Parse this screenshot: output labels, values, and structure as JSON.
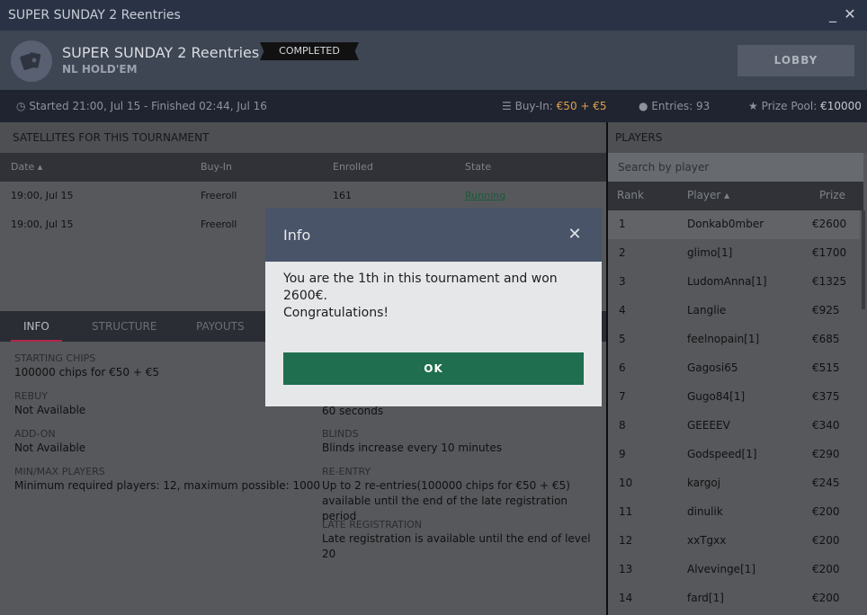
{
  "window": {
    "title": "SUPER SUNDAY 2 Reentries",
    "minimize": "_",
    "close": "✕"
  },
  "header": {
    "name": "SUPER SUNDAY 2 Reentries",
    "game": "NL HOLD'EM",
    "status": "COMPLETED",
    "lobby_label": "LOBBY"
  },
  "infobar": {
    "timing": "Started 21:00, Jul 15  -  Finished 02:44, Jul 16",
    "buyin_label": "Buy-In:",
    "buyin_value": "€50 + €5",
    "entries": "Entries: 93",
    "prize_label": "Prize Pool:",
    "prize_value": "€10000"
  },
  "satellites": {
    "title": "SATELLITES FOR THIS TOURNAMENT",
    "columns": [
      "Date ▴",
      "Buy-In",
      "Enrolled",
      "State"
    ],
    "rows": [
      {
        "date": "19:00, Jul 15",
        "buyin": "Freeroll",
        "enrolled": "161",
        "state": "Running"
      },
      {
        "date": "19:00, Jul 15",
        "buyin": "Freeroll",
        "enrolled": "",
        "state": ""
      }
    ]
  },
  "tabs": [
    "INFO",
    "STRUCTURE",
    "PAYOUTS"
  ],
  "details": {
    "starting_chips": {
      "label": "STARTING CHIPS",
      "value": "100000 chips for €50 + €5"
    },
    "rebuy": {
      "label": "REBUY",
      "value": "Not Available"
    },
    "addon": {
      "label": "ADD-ON",
      "value": "Not Available"
    },
    "minmax": {
      "label": "MIN/MAX PLAYERS",
      "value": "Minimum required players: 12, maximum possible: 1000"
    },
    "time_value": "60 seconds",
    "blinds": {
      "label": "BLINDS",
      "value": "Blinds increase every 10 minutes"
    },
    "reentry": {
      "label": "RE-ENTRY",
      "value": "Up to 2 re-entries(100000 chips for €50 + €5) available until the end of the late registration period"
    },
    "late_reg": {
      "label": "LATE REGISTRATION",
      "value": "Late registration is available until the end of level 20"
    }
  },
  "players": {
    "title": "PLAYERS",
    "search_placeholder": "Search by player",
    "columns": [
      "Rank",
      "Player ▴",
      "Prize"
    ],
    "rows": [
      {
        "rank": "1",
        "player": "Donkab0mber",
        "prize": "€2600"
      },
      {
        "rank": "2",
        "player": "glimo[1]",
        "prize": "€1700"
      },
      {
        "rank": "3",
        "player": "LudomAnna[1]",
        "prize": "€1325"
      },
      {
        "rank": "4",
        "player": "Langlie",
        "prize": "€925"
      },
      {
        "rank": "5",
        "player": "feelnopain[1]",
        "prize": "€685"
      },
      {
        "rank": "6",
        "player": "Gagosi65",
        "prize": "€515"
      },
      {
        "rank": "7",
        "player": "Gugo84[1]",
        "prize": "€375"
      },
      {
        "rank": "8",
        "player": "GEEEEV",
        "prize": "€340"
      },
      {
        "rank": "9",
        "player": "Godspeed[1]",
        "prize": "€290"
      },
      {
        "rank": "10",
        "player": "kargoj",
        "prize": "€245"
      },
      {
        "rank": "11",
        "player": "dinulik",
        "prize": "€200"
      },
      {
        "rank": "12",
        "player": "xxTgxx",
        "prize": "€200"
      },
      {
        "rank": "13",
        "player": "Alvevinge[1]",
        "prize": "€200"
      },
      {
        "rank": "14",
        "player": "fard[1]",
        "prize": "€200"
      }
    ]
  },
  "dialog": {
    "title": "Info",
    "close": "✕",
    "line1": "You are the 1th in this tournament and won",
    "line2": "2600€.",
    "line3": "Congratulations!",
    "ok_label": "OK"
  }
}
